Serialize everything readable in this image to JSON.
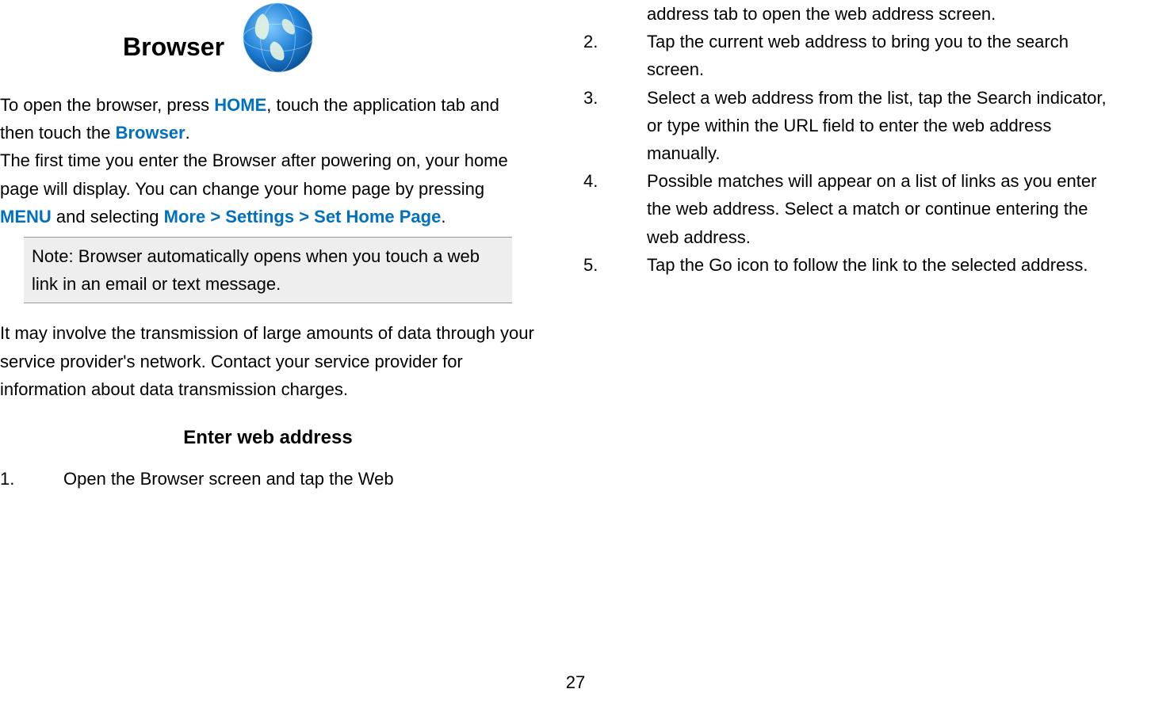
{
  "header": {
    "title": "Browser"
  },
  "left": {
    "para1_part1": "To open the browser, press ",
    "para1_hl1": "HOME",
    "para1_part2": ", touch the application tab and then touch the ",
    "para1_hl2": "Browser",
    "para1_part3": ".",
    "para2_part1": "The first time you enter the Browser after powering on, your home page will display. You can change your home page by pressing ",
    "para2_hl1": "MENU",
    "para2_part2": " and selecting ",
    "para2_hl2": "More > Settings > Set Home Page",
    "para2_part3": ".",
    "note": "Note: Browser automatically opens when you touch a web link in an email or text message.",
    "para3": "It may involve the transmission of large amounts of data through your service provider's network. Contact your service provider for information about data transmission charges.",
    "subheading": "Enter web address",
    "item1_num": "1.",
    "item1_text": "Open the Browser screen and tap the Web"
  },
  "right": {
    "item1_cont": "address tab to open the web address screen.",
    "item2_num": "2.",
    "item2_text": "Tap the current web address to bring you to the search screen.",
    "item3_num": "3.",
    "item3_text": "Select a web address from the list, tap the Search indicator, or type within the URL field to enter the web address manually.",
    "item4_num": "4.",
    "item4_text": "Possible matches will appear on a list of links as you enter the web address. Select a match or continue entering the web address.",
    "item5_num": "5.",
    "item5_text": "Tap the Go icon to follow the link to the selected address."
  },
  "pageNumber": "27"
}
